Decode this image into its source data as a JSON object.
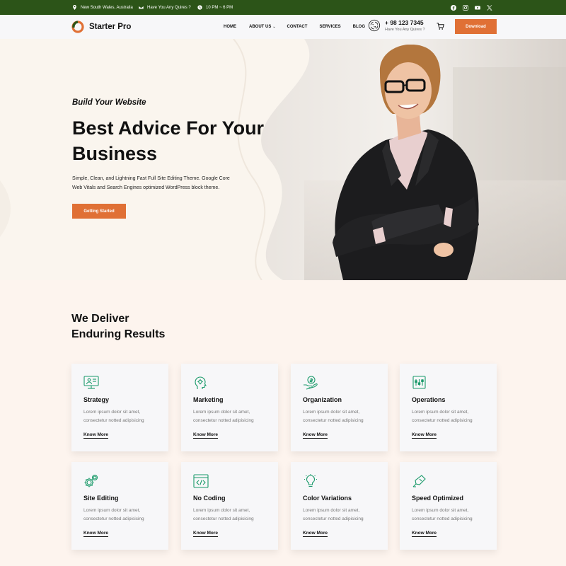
{
  "topbar": {
    "location": "New South Wales, Australia",
    "queries": "Have You Any Quires ?",
    "hours": "10 PM ~ 6 PM",
    "social": [
      "facebook-icon",
      "instagram-icon",
      "youtube-icon",
      "x-icon"
    ]
  },
  "header": {
    "brand": "Starter Pro",
    "nav": [
      "HOME",
      "ABOUT US",
      "CONTACT",
      "SERVICES",
      "BLOG"
    ],
    "phone": "+ 98 123 7345",
    "phone_sub": "Have You Any Quires ?",
    "download_label": "Download"
  },
  "hero": {
    "subtitle": "Build Your Website",
    "title_line1": "Best Advice For Your",
    "title_line2": "Business",
    "description": "Simple, Clean, and Lightning Fast Full Site Editing Theme. Google Core Web Vitals and Search Engines optimized WordPress block theme.",
    "cta_label": "Getting Started"
  },
  "services": {
    "title_line1": "We Deliver",
    "title_line2": "Enduring Results",
    "cards": [
      {
        "title": "Strategy",
        "desc_line1": "Lorem ipsum dolor sit amet,",
        "desc_line2": "consectetur notted adipisicing",
        "link": "Know More",
        "icon": "strategy-icon"
      },
      {
        "title": "Marketing",
        "desc_line1": "Lorem ipsum dolor sit amet,",
        "desc_line2": "consectetur notted adipisicing",
        "link": "Know More",
        "icon": "marketing-icon"
      },
      {
        "title": "Organization",
        "desc_line1": "Lorem ipsum dolor sit amet,",
        "desc_line2": "consectetur notted adipisicing",
        "link": "Know More",
        "icon": "organization-icon"
      },
      {
        "title": "Operations",
        "desc_line1": "Lorem ipsum dolor sit amet,",
        "desc_line2": "consectetur notted adipisicing",
        "link": "Know More",
        "icon": "operations-icon"
      },
      {
        "title": "Site Editing",
        "desc_line1": "Lorem ipsum dolor sit amet,",
        "desc_line2": "consectetur notted adipisicing",
        "link": "Know More",
        "icon": "gears-icon"
      },
      {
        "title": "No Coding",
        "desc_line1": "Lorem ipsum dolor sit amet,",
        "desc_line2": "consectetur notted adipisicing",
        "link": "Know More",
        "icon": "code-icon"
      },
      {
        "title": "Color Variations",
        "desc_line1": "Lorem ipsum dolor sit amet,",
        "desc_line2": "consectetur notted adipisicing",
        "link": "Know More",
        "icon": "lightbulb-icon"
      },
      {
        "title": "Speed Optimized",
        "desc_line1": "Lorem ipsum dolor sit amet,",
        "desc_line2": "consectetur notted adipisicing",
        "link": "Know More",
        "icon": "speed-icon"
      }
    ]
  },
  "colors": {
    "topbar": "#2c5418",
    "accent": "#e07035",
    "icon_green": "#1a9a6a",
    "hero_bg": "#faf5ee",
    "services_bg": "#fdf4ee"
  }
}
